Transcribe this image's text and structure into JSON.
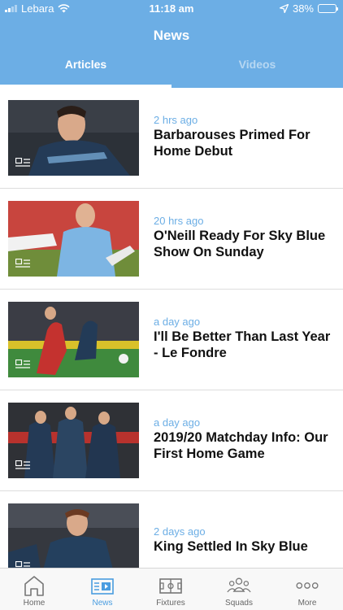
{
  "status_bar": {
    "carrier": "Lebara",
    "time": "11:18 am",
    "battery": "38%",
    "battery_level": 0.38
  },
  "header": {
    "title": "News"
  },
  "tabs": [
    {
      "label": "Articles",
      "active": true
    },
    {
      "label": "Videos",
      "active": false
    }
  ],
  "articles": [
    {
      "time": "2 hrs ago",
      "title": "Barbarouses Primed For Home Debut"
    },
    {
      "time": "20 hrs ago",
      "title": "O'Neill Ready For Sky Blue Show On Sunday"
    },
    {
      "time": "a day ago",
      "title": "I'll Be Better Than Last Year - Le Fondre"
    },
    {
      "time": "a day ago",
      "title": "2019/20 Matchday Info: Our First Home Game"
    },
    {
      "time": "2 days ago",
      "title": "King Settled In Sky Blue"
    }
  ],
  "tab_bar": [
    {
      "label": "Home",
      "icon": "home-icon",
      "active": false
    },
    {
      "label": "News",
      "icon": "news-icon",
      "active": true
    },
    {
      "label": "Fixtures",
      "icon": "fixtures-icon",
      "active": false
    },
    {
      "label": "Squads",
      "icon": "squads-icon",
      "active": false
    },
    {
      "label": "More",
      "icon": "more-icon",
      "active": false
    }
  ],
  "colors": {
    "accent": "#6caee5",
    "active_tab": "#4a9de0",
    "headline": "#111111",
    "divider": "#dddddd"
  }
}
